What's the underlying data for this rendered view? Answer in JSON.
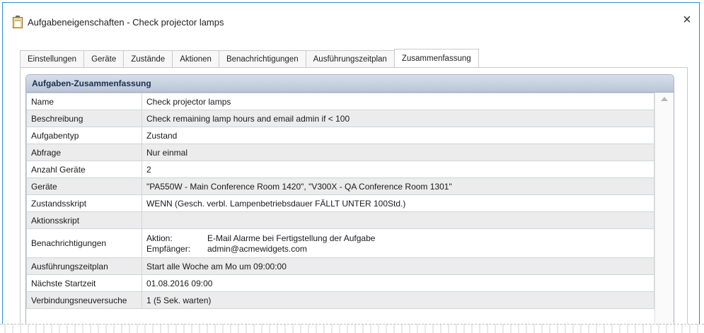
{
  "window": {
    "title": "Aufgabeneigenschaften - Check projector lamps",
    "close_symbol": "×"
  },
  "tabs": [
    {
      "label": "Einstellungen",
      "active": false
    },
    {
      "label": "Geräte",
      "active": false
    },
    {
      "label": "Zustände",
      "active": false
    },
    {
      "label": "Aktionen",
      "active": false
    },
    {
      "label": "Benachrichtigungen",
      "active": false
    },
    {
      "label": "Ausführungszeitplan",
      "active": false
    },
    {
      "label": "Zusammenfassung",
      "active": true
    }
  ],
  "summary": {
    "header": "Aufgaben-Zusammenfassung",
    "rows": [
      {
        "label": "Name",
        "value": "Check projector lamps"
      },
      {
        "label": "Beschreibung",
        "value": "Check remaining lamp hours and email admin if < 100"
      },
      {
        "label": "Aufgabentyp",
        "value": "Zustand"
      },
      {
        "label": "Abfrage",
        "value": "Nur einmal"
      },
      {
        "label": "Anzahl Geräte",
        "value": "2"
      },
      {
        "label": "Geräte",
        "value": "\"PA550W - Main Conference Room 1420\",  \"V300X - QA Conference Room 1301\""
      },
      {
        "label": "Zustandsskript",
        "value": "WENN (Gesch. verbl. Lampenbetriebsdauer FÄLLT UNTER 100Std.)"
      },
      {
        "label": "Aktionsskript",
        "value": ""
      },
      {
        "label": "Benachrichtigungen",
        "action_label": "Aktion:",
        "action_value": "E-Mail Alarme bei Fertigstellung der Aufgabe",
        "recipient_label": "Empfänger:",
        "recipient_value": "admin@acmewidgets.com"
      },
      {
        "label": "Ausführungszeitplan",
        "value": "Start alle Woche am Mo um 09:00:00"
      },
      {
        "label": "Nächste Startzeit",
        "value": "01.08.2016 09:00"
      },
      {
        "label": "Verbindungsneuversuche",
        "value": "1 (5 Sek. warten)"
      }
    ]
  },
  "colors": {
    "window_border": "#2a8dd4",
    "header_gradient_top": "#d7dfea",
    "header_gradient_bottom": "#b9c6d7",
    "alt_row": "#ececec"
  },
  "icons": {
    "title": "clipboard-icon",
    "close": "close-icon",
    "scroll_up": "scroll-up-arrow-icon"
  }
}
